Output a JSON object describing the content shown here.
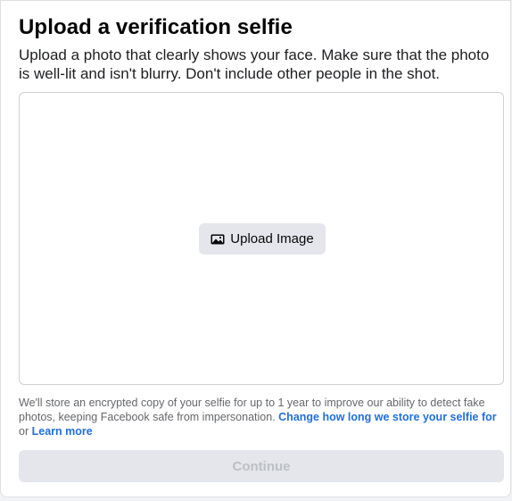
{
  "dialog": {
    "title": "Upload a verification selfie",
    "description": "Upload a photo that clearly shows your face. Make sure that the photo is well-lit and isn't blurry. Don't include other people in the shot."
  },
  "dropzone": {
    "upload_label": "Upload Image",
    "upload_icon": "image-icon"
  },
  "footnote": {
    "text": "We'll store an encrypted copy of your selfie for up to 1 year to improve our ability to detect fake photos, keeping Facebook safe from impersonation.",
    "link_retention": "Change how long we store your selfie for",
    "connector": "or",
    "link_learn_more": "Learn more"
  },
  "actions": {
    "continue_label": "Continue",
    "continue_enabled": false
  },
  "colors": {
    "link": "#216fdb",
    "button_bg": "#e4e6eb",
    "disabled_text": "#bcc0c4"
  }
}
